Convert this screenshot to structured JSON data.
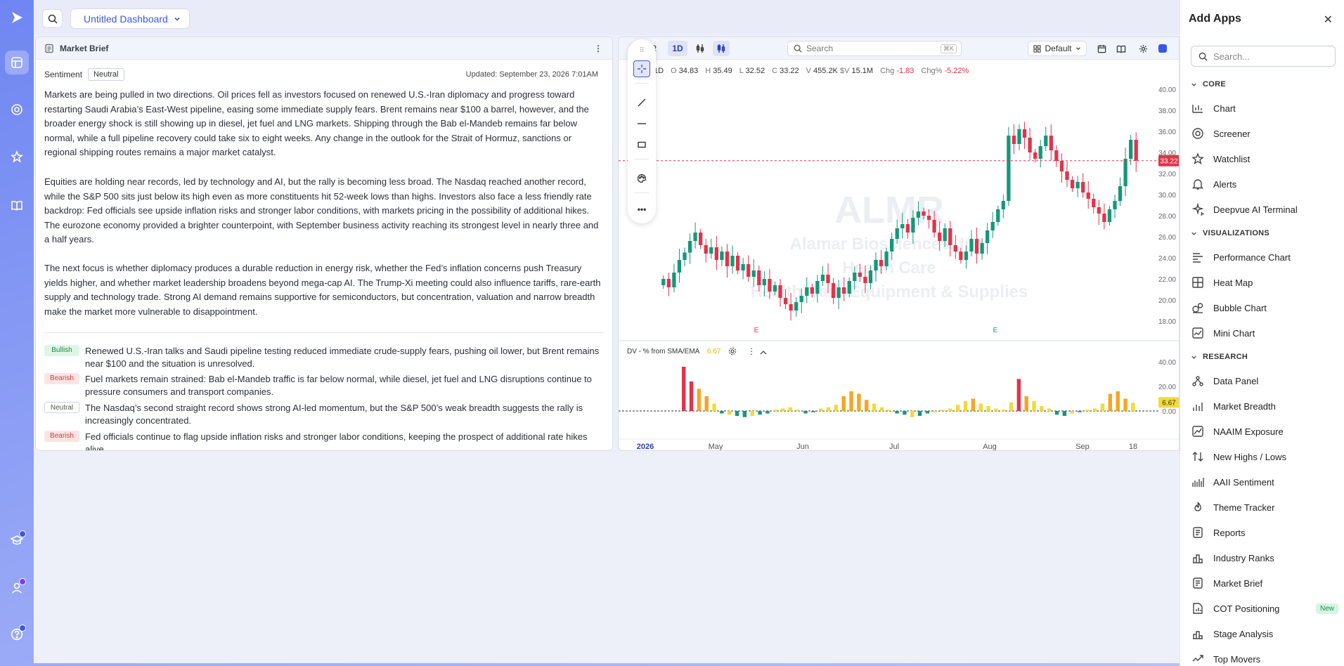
{
  "topbar": {
    "dashboard_title": "Untitled Dashboard"
  },
  "brief": {
    "title": "Market Brief",
    "sentiment_label": "Sentiment",
    "sentiment_value": "Neutral",
    "updated": "Updated: September 23, 2026 7:01AM",
    "paragraphs": [
      "Markets are being pulled in two directions. Oil prices fell as investors focused on renewed U.S.-Iran diplomacy and progress toward restarting Saudi Arabia’s East-West pipeline, easing some immediate supply fears. Brent remains near $100 a barrel, however, and the broader energy shock is still showing up in diesel, jet fuel and LNG markets. Shipping through the Bab el-Mandeb remains far below normal, while a full pipeline recovery could take six to eight weeks. Any change in the outlook for the Strait of Hormuz, sanctions or regional shipping routes remains a major market catalyst.",
      "Equities are holding near records, led by technology and AI, but the rally is becoming less broad. The Nasdaq reached another record, while the S&P 500 sits just below its high even as more constituents hit 52-week lows than highs. Investors also face a less friendly rate backdrop: Fed officials see upside inflation risks and stronger labor conditions, with markets pricing in the possibility of additional hikes. The eurozone economy provided a brighter counterpoint, with September business activity reaching its strongest level in nearly three and a half years.",
      "The next focus is whether diplomacy produces a durable reduction in energy risk, whether the Fed’s inflation concerns push Treasury yields higher, and whether market leadership broadens beyond mega-cap AI. The Trump-Xi meeting could also influence tariffs, rare-earth supply and technology trade. Strong AI demand remains supportive for semiconductors, but concentration, valuation and narrow breadth make the market more vulnerable to disappointment."
    ],
    "bullets": [
      {
        "tag": "Bullish",
        "text": "Renewed U.S.-Iran talks and Saudi pipeline testing reduced immediate crude-supply fears, pushing oil lower, but Brent remains near $100 and the situation is unresolved."
      },
      {
        "tag": "Bearish",
        "text": "Fuel markets remain strained: Bab el-Mandeb traffic is far below normal, while diesel, jet fuel and LNG disruptions continue to pressure consumers and transport companies."
      },
      {
        "tag": "Neutral",
        "text": "The Nasdaq’s second straight record shows strong AI-led momentum, but the S&P 500’s weak breadth suggests the rally is increasingly concentrated."
      },
      {
        "tag": "Bearish",
        "text": "Fed officials continue to flag upside inflation risks and stronger labor conditions, keeping the prospect of additional rate hikes alive."
      }
    ]
  },
  "chart": {
    "interval": "1D",
    "search_placeholder": "Search",
    "search_shortcut": "⌘K",
    "layout": "Default",
    "ticker_fragment": "R",
    "ohlc": {
      "interval": "1D",
      "o_label": "O",
      "o": "34.83",
      "h_label": "H",
      "h": "35.49",
      "l_label": "L",
      "l": "32.52",
      "c_label": "C",
      "c": "33.22",
      "v_label": "V",
      "v": "455.2K",
      "dv_label": "$V",
      "dv": "15.1M",
      "chg_label": "Chg",
      "chg": "-1.83",
      "chgp_label": "Chg%",
      "chgp": "-5.22%"
    },
    "watermark": {
      "ticker": "ALMR",
      "name": "Alamar Biosciences, Inc.",
      "sector": "Health Care",
      "industry": "Health Care Equipment & Supplies"
    },
    "last_price_label": "33.22",
    "indicator_label": "DV - % from SMA/EMA",
    "indicator_value": "6.67",
    "colors": {
      "up": "#15977a",
      "down": "#e2334a",
      "accent": "#3b57e8",
      "indicator_orange": "#f5a623",
      "indicator_yellow": "#f5d83a"
    }
  },
  "chart_data": {
    "type": "candlestick",
    "y_ticks": [
      "40.00",
      "38.00",
      "36.00",
      "34.00",
      "32.00",
      "30.00",
      "28.00",
      "26.00",
      "24.00",
      "22.00",
      "20.00",
      "18.00"
    ],
    "ylim": [
      18,
      40
    ],
    "x_ticks": [
      "2026",
      "May",
      "Jun",
      "Jul",
      "Aug",
      "Sep",
      "18"
    ],
    "earnings_markers": [
      "E",
      "E"
    ],
    "indicator_y_ticks": [
      "40.00",
      "20.00",
      "0.00"
    ],
    "last_close": 33.22,
    "closes": [
      22.0,
      21.2,
      22.6,
      23.8,
      24.5,
      25.6,
      26.4,
      25.2,
      24.4,
      25.0,
      23.8,
      24.6,
      23.2,
      24.2,
      22.8,
      23.4,
      22.2,
      22.8,
      21.4,
      22.0,
      20.8,
      21.4,
      20.2,
      19.6,
      19.0,
      19.8,
      20.4,
      21.2,
      20.6,
      21.8,
      22.4,
      21.6,
      20.2,
      21.2,
      20.6,
      21.8,
      22.6,
      22.2,
      21.6,
      22.8,
      23.8,
      23.2,
      24.6,
      25.8,
      26.8,
      27.2,
      26.4,
      27.8,
      28.4,
      28.0,
      27.6,
      26.4,
      25.6,
      26.8,
      25.2,
      24.6,
      23.8,
      24.6,
      25.8,
      24.4,
      25.4,
      26.6,
      27.4,
      28.6,
      29.4,
      35.6,
      34.8,
      36.2,
      35.4,
      34.0,
      33.4,
      34.6,
      35.6,
      34.2,
      33.2,
      32.2,
      31.4,
      30.6,
      31.2,
      30.2,
      29.6,
      28.8,
      28.2,
      27.4,
      28.6,
      29.4,
      30.8,
      33.4,
      35.2,
      33.22
    ],
    "indicator_values": [
      36,
      24,
      18,
      12,
      6,
      -2,
      -3,
      -4,
      -5,
      -4,
      -3,
      -2,
      1,
      2,
      3,
      1,
      -2,
      -1,
      2,
      3,
      5,
      12,
      16,
      14,
      9,
      6,
      3,
      1,
      -2,
      -3,
      -5,
      -4,
      -2,
      -1,
      1,
      2,
      5,
      8,
      10,
      6,
      4,
      2,
      1,
      7,
      26,
      12,
      8,
      4,
      2,
      -3,
      -4,
      -2,
      -1,
      1,
      2,
      6,
      14,
      16,
      10,
      6.67
    ]
  },
  "apps": {
    "title": "Add Apps",
    "search_placeholder": "Search...",
    "sections": [
      {
        "name": "CORE",
        "items": [
          "Chart",
          "Screener",
          "Watchlist",
          "Alerts",
          "Deepvue AI Terminal"
        ]
      },
      {
        "name": "VISUALIZATIONS",
        "items": [
          "Performance Chart",
          "Heat Map",
          "Bubble Chart",
          "Mini Chart"
        ]
      },
      {
        "name": "RESEARCH",
        "items": [
          "Data Panel",
          "Market Breadth",
          "NAAIM Exposure",
          "New Highs / Lows",
          "AAII Sentiment",
          "Theme Tracker",
          "Reports",
          "Industry Ranks",
          "Market Brief",
          "COT Positioning",
          "Stage Analysis",
          "Top Movers"
        ]
      }
    ],
    "new_badge": "New"
  }
}
